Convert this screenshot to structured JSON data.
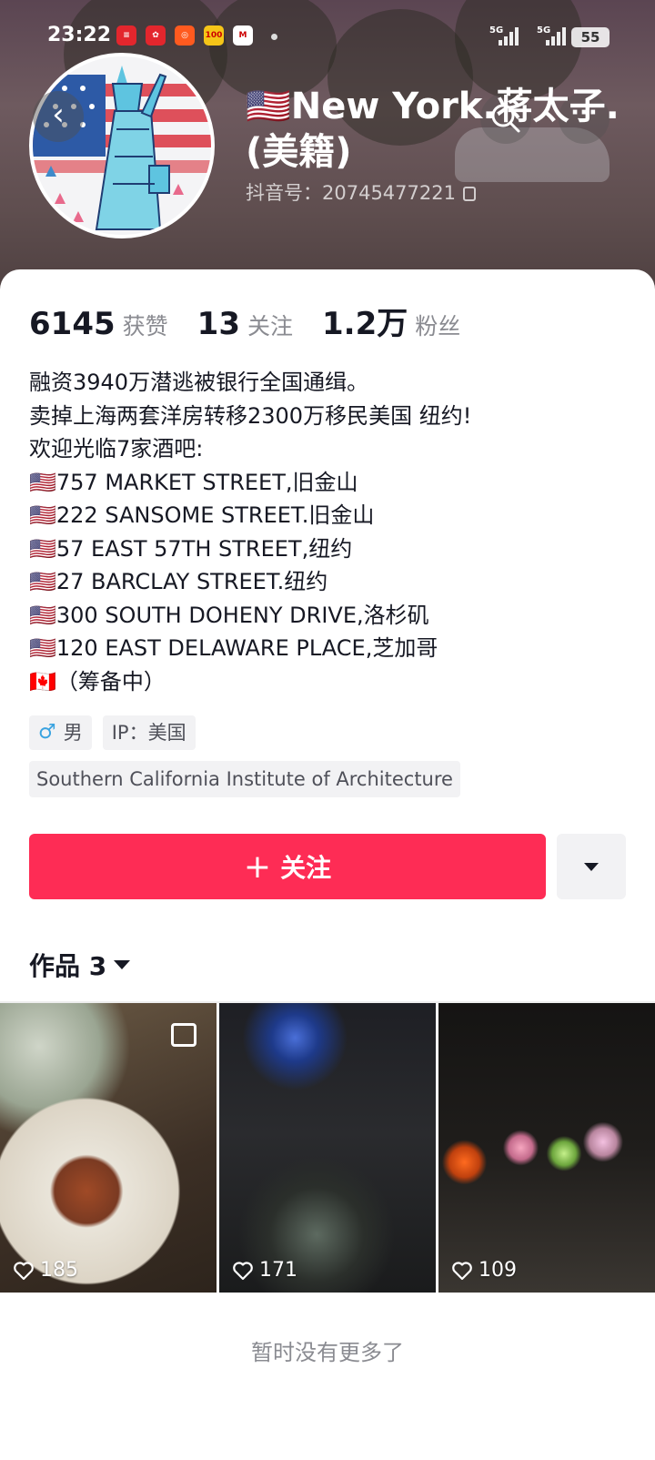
{
  "status_bar": {
    "time": "23:22",
    "network_1": "5G",
    "network_2": "5G",
    "battery": "55"
  },
  "profile": {
    "nickname_line1": "🇺🇸New York.蒋太子.",
    "nickname_line2": "(美籍)",
    "douyin_id_label": "抖音号：",
    "douyin_id": "20745477221"
  },
  "stats": [
    {
      "value": "6145",
      "label": "获赞"
    },
    {
      "value": "13",
      "label": "关注"
    },
    {
      "value": "1.2万",
      "label": "粉丝"
    }
  ],
  "bio": [
    "融资3940万潜逃被银行全国通缉。",
    "卖掉上海两套洋房转移2300万移民美国 纽约!",
    "欢迎光临7家酒吧:",
    "🇺🇸757 MARKET STREET,旧金山",
    "🇺🇸222 SANSOME STREET.旧金山",
    "🇺🇸57 EAST 57TH STREET,纽约",
    "🇺🇸27 BARCLAY STREET.纽约",
    "🇺🇸300 SOUTH DOHENY DRIVE,洛杉矶",
    "🇺🇸120 EAST DELAWARE PLACE,芝加哥",
    "🇨🇦（筹备中）"
  ],
  "tags": {
    "gender": "男",
    "ip": "IP：美国",
    "school": "Southern California Institute of Architecture"
  },
  "actions": {
    "follow_label": "关注"
  },
  "works": {
    "tab_label": "作品 3",
    "items": [
      {
        "likes": "185",
        "icon": "multi-image-icon"
      },
      {
        "likes": "171"
      },
      {
        "likes": "109"
      }
    ]
  },
  "footer": {
    "no_more": "暂时没有更多了"
  },
  "colors": {
    "accent": "#fe2c55",
    "tag_bg": "#f2f2f4",
    "muted_text": "#8a8b91"
  }
}
